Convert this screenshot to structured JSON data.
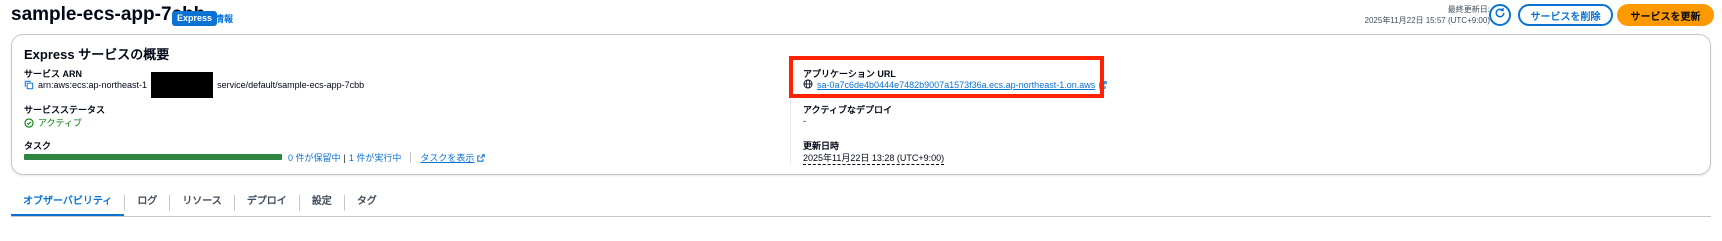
{
  "header": {
    "service_name": "sample-ecs-app-7cbb",
    "badge": "Express",
    "info": "情報",
    "last_updated_label": "最終更新日:",
    "last_updated_value": "2025年11月22日 15:57 (UTC+9:00)",
    "refresh_icon": "refresh-icon",
    "delete_button": "サービスを削除",
    "update_button": "サービスを更新"
  },
  "overview": {
    "title": "Express サービスの概要",
    "arn_label": "サービス ARN",
    "arn_prefix": "arn:aws:ecs:ap-northeast-1",
    "arn_suffix": "service/default/sample-ecs-app-7cbb",
    "status_label": "サービスステータス",
    "status_value": "アクティブ",
    "tasks_label": "タスク",
    "tasks_pending": "0 件が保留中",
    "tasks_running": "1 件が実行中",
    "tasks_link": "タスクを表示",
    "app_url_label": "アプリケーション URL",
    "app_url_value": "sa-0a7c6de4b0444e7482b9007a1573f36a.ecs.ap-northeast-1.on.aws",
    "deploy_label": "アクティブなデプロイ",
    "deploy_value": "-",
    "updated_label": "更新日時",
    "updated_value": "2025年11月22日 13:28 (UTC+9:00)"
  },
  "tabs": [
    {
      "label": "オブザーバビリティ",
      "active": true
    },
    {
      "label": "ログ"
    },
    {
      "label": "リソース"
    },
    {
      "label": "デプロイ"
    },
    {
      "label": "設定"
    },
    {
      "label": "タグ"
    }
  ],
  "colors": {
    "accent": "#0972d3",
    "primary_button": "#ff9900",
    "success": "#037f0c",
    "highlight_box": "#ff2200"
  }
}
